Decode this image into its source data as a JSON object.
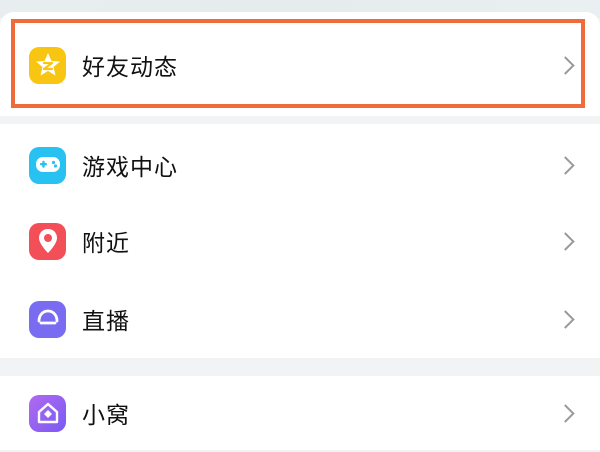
{
  "menu": {
    "items": [
      {
        "label": "好友动态",
        "icon": "qzone-star-icon",
        "color": "#f7c512"
      },
      {
        "label": "游戏中心",
        "icon": "gamepad-icon",
        "color": "#27c2f2"
      },
      {
        "label": "附近",
        "icon": "location-pin-icon",
        "color": "#f24f59"
      },
      {
        "label": "直播",
        "icon": "live-broadcast-icon",
        "color": "#7a6cf2"
      },
      {
        "label": "小窝",
        "icon": "home-diamond-icon",
        "color": "#9a63f2"
      }
    ]
  },
  "highlight": {
    "color": "#ef6b3c",
    "target": "好友动态"
  }
}
